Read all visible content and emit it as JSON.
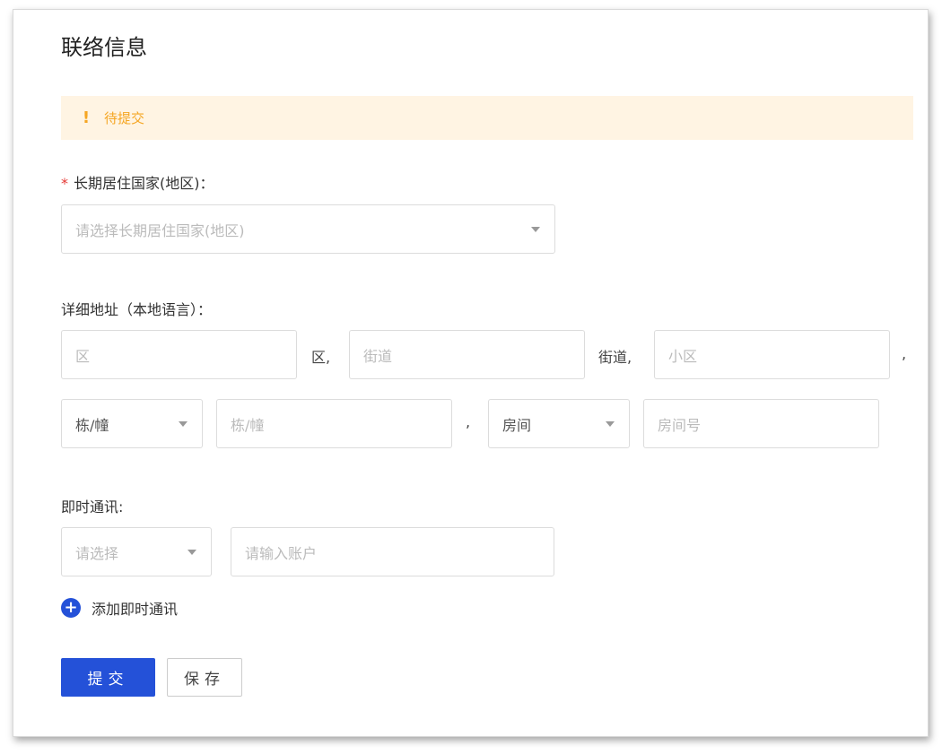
{
  "title": "联络信息",
  "alert": {
    "icon": "!",
    "text": "待提交"
  },
  "country": {
    "required_mark": "*",
    "label": "长期居住国家(地区)：",
    "placeholder": "请选择长期居住国家(地区)"
  },
  "address": {
    "label": "详细地址（本地语言）：",
    "district_placeholder": "区",
    "district_suffix": "区,",
    "street_placeholder": "街道",
    "street_suffix": "街道,",
    "community_placeholder": "小区",
    "community_suffix": ",",
    "building_select": "栋/幢",
    "building_placeholder": "栋/幢",
    "building_suffix": ",",
    "room_select": "房间",
    "room_placeholder": "房间号"
  },
  "im": {
    "label": "即时通讯:",
    "type_placeholder": "请选择",
    "account_placeholder": "请输入账户",
    "add_label": "添加即时通讯",
    "add_icon": "+"
  },
  "buttons": {
    "submit": "提交",
    "save": "保存"
  },
  "colors": {
    "primary": "#2451d8",
    "warning": "#f5a623",
    "warning_bg": "#fff4e3",
    "required": "#e53935"
  }
}
